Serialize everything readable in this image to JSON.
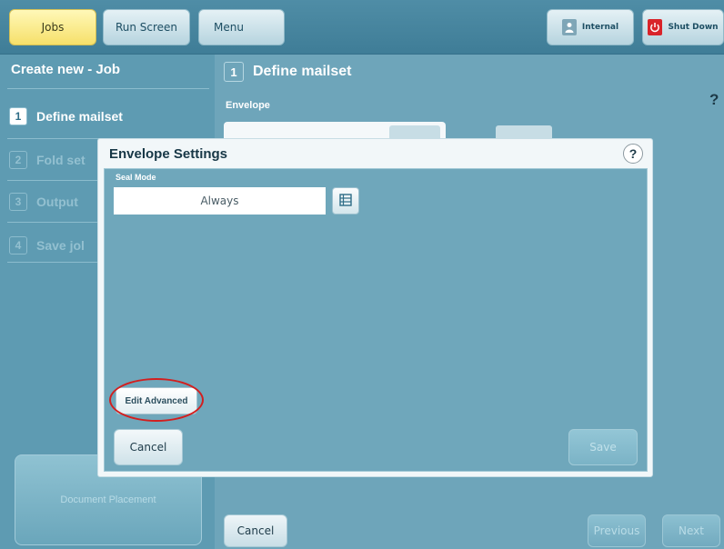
{
  "topbar": {
    "jobs": "Jobs",
    "run_screen": "Run Screen",
    "menu": "Menu",
    "internal": "Internal",
    "shut_down": "Shut Down"
  },
  "sidebar": {
    "title": "Create new - Job",
    "steps": [
      {
        "num": "1",
        "label": "Define mailset"
      },
      {
        "num": "2",
        "label": "Fold set"
      },
      {
        "num": "3",
        "label": "Output"
      },
      {
        "num": "4",
        "label": "Save jol"
      }
    ],
    "document_placement": "Document Placement"
  },
  "main": {
    "step_num": "1",
    "heading": "Define mailset",
    "envelope_label": "Envelope",
    "help": "?",
    "cancel": "Cancel",
    "previous": "Previous",
    "next": "Next"
  },
  "dialog": {
    "title": "Envelope Settings",
    "help": "?",
    "seal_mode_label": "Seal Mode",
    "seal_mode_value": "Always",
    "edit_advanced": "Edit Advanced",
    "cancel": "Cancel",
    "save": "Save"
  },
  "icons": {
    "internal": "user-icon",
    "shut_down": "power-icon",
    "seal_list": "list-icon"
  },
  "colors": {
    "active_tab": "#f6e06a",
    "background": "#6ea5ba",
    "highlight_ring": "#d21f1f",
    "shutdown_red": "#d9242a"
  }
}
